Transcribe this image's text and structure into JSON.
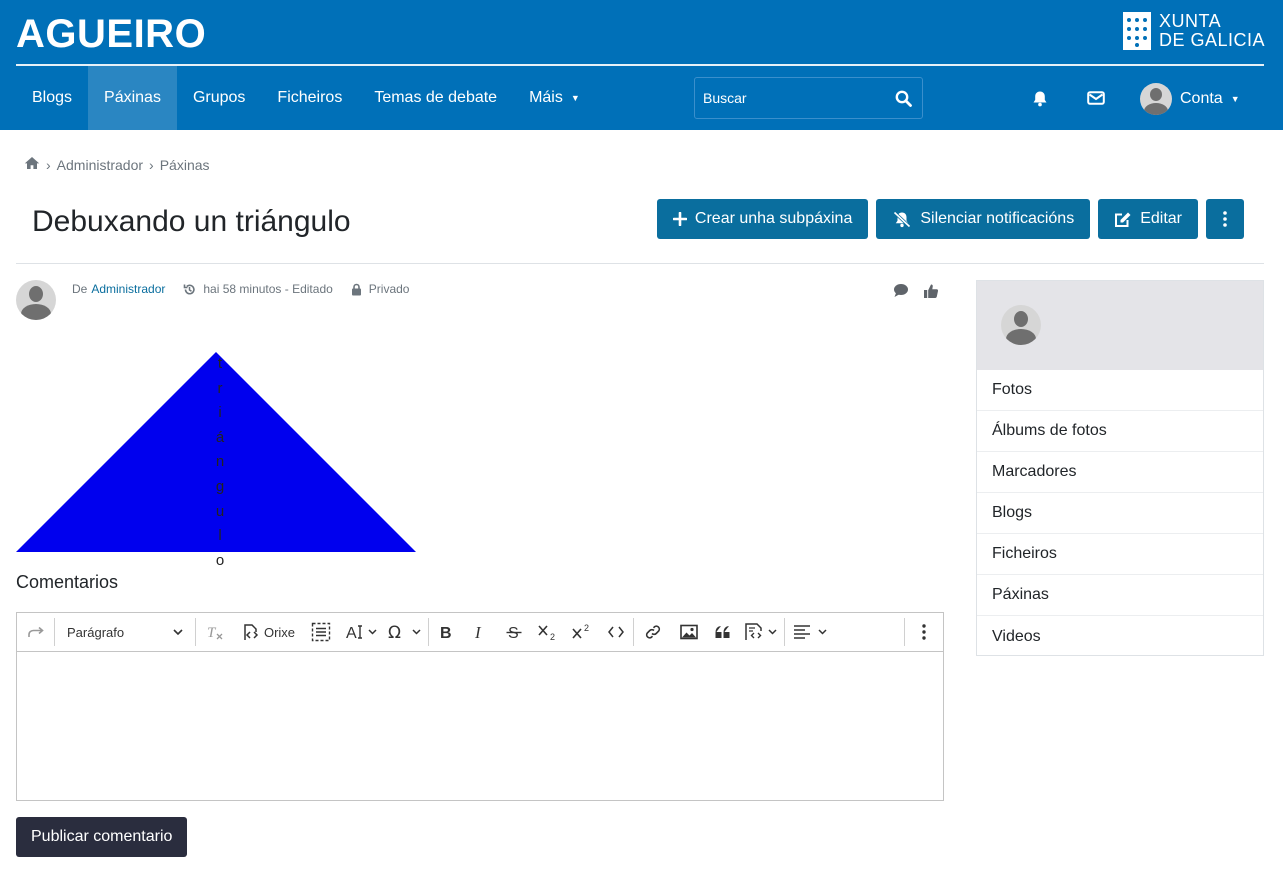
{
  "header": {
    "site_title": "AGUEIRO",
    "brand_line1": "XUNTA",
    "brand_line2": "DE GALICIA",
    "colors": {
      "header_bg": "#0070b8",
      "active_nav": "#2a86c2",
      "button": "#0a6e9e",
      "dark_button": "#2a2d3e"
    },
    "nav": {
      "blogs": "Blogs",
      "paxinas": "Páxinas",
      "grupos": "Grupos",
      "ficheiros": "Ficheiros",
      "temas": "Temas de debate",
      "mais": "Máis"
    },
    "active_nav": "Páxinas",
    "search_placeholder": "Buscar",
    "account_label": "Conta",
    "icons": [
      "bell-icon",
      "envelope-icon",
      "search-icon"
    ]
  },
  "breadcrumb": {
    "home_icon": "home-icon",
    "items": [
      "Administrador",
      "Páxinas"
    ]
  },
  "page": {
    "title": "Debuxando un triángulo",
    "actions": {
      "create_subpage": "Crear unha subpáxina",
      "mute_notifications": "Silenciar notificacións",
      "edit": "Editar"
    },
    "meta": {
      "by_prefix": "De",
      "author": "Administrador",
      "time": "hai 58 minutos - Editado",
      "visibility": "Privado"
    }
  },
  "content": {
    "shape_color": "#0000ee",
    "letters": [
      "t",
      "r",
      "i",
      "á",
      "n",
      "g",
      "u",
      "l",
      "o"
    ]
  },
  "comments": {
    "title": "Comentarios",
    "paragraph_select": "Parágrafo",
    "source_label": "Orixe",
    "publish_button": "Publicar comentario"
  },
  "sidebar": {
    "items": {
      "fotos": "Fotos",
      "albums": "Álbums de fotos",
      "marcadores": "Marcadores",
      "blogs": "Blogs",
      "ficheiros": "Ficheiros",
      "paxinas": "Páxinas",
      "videos": "Videos"
    }
  }
}
